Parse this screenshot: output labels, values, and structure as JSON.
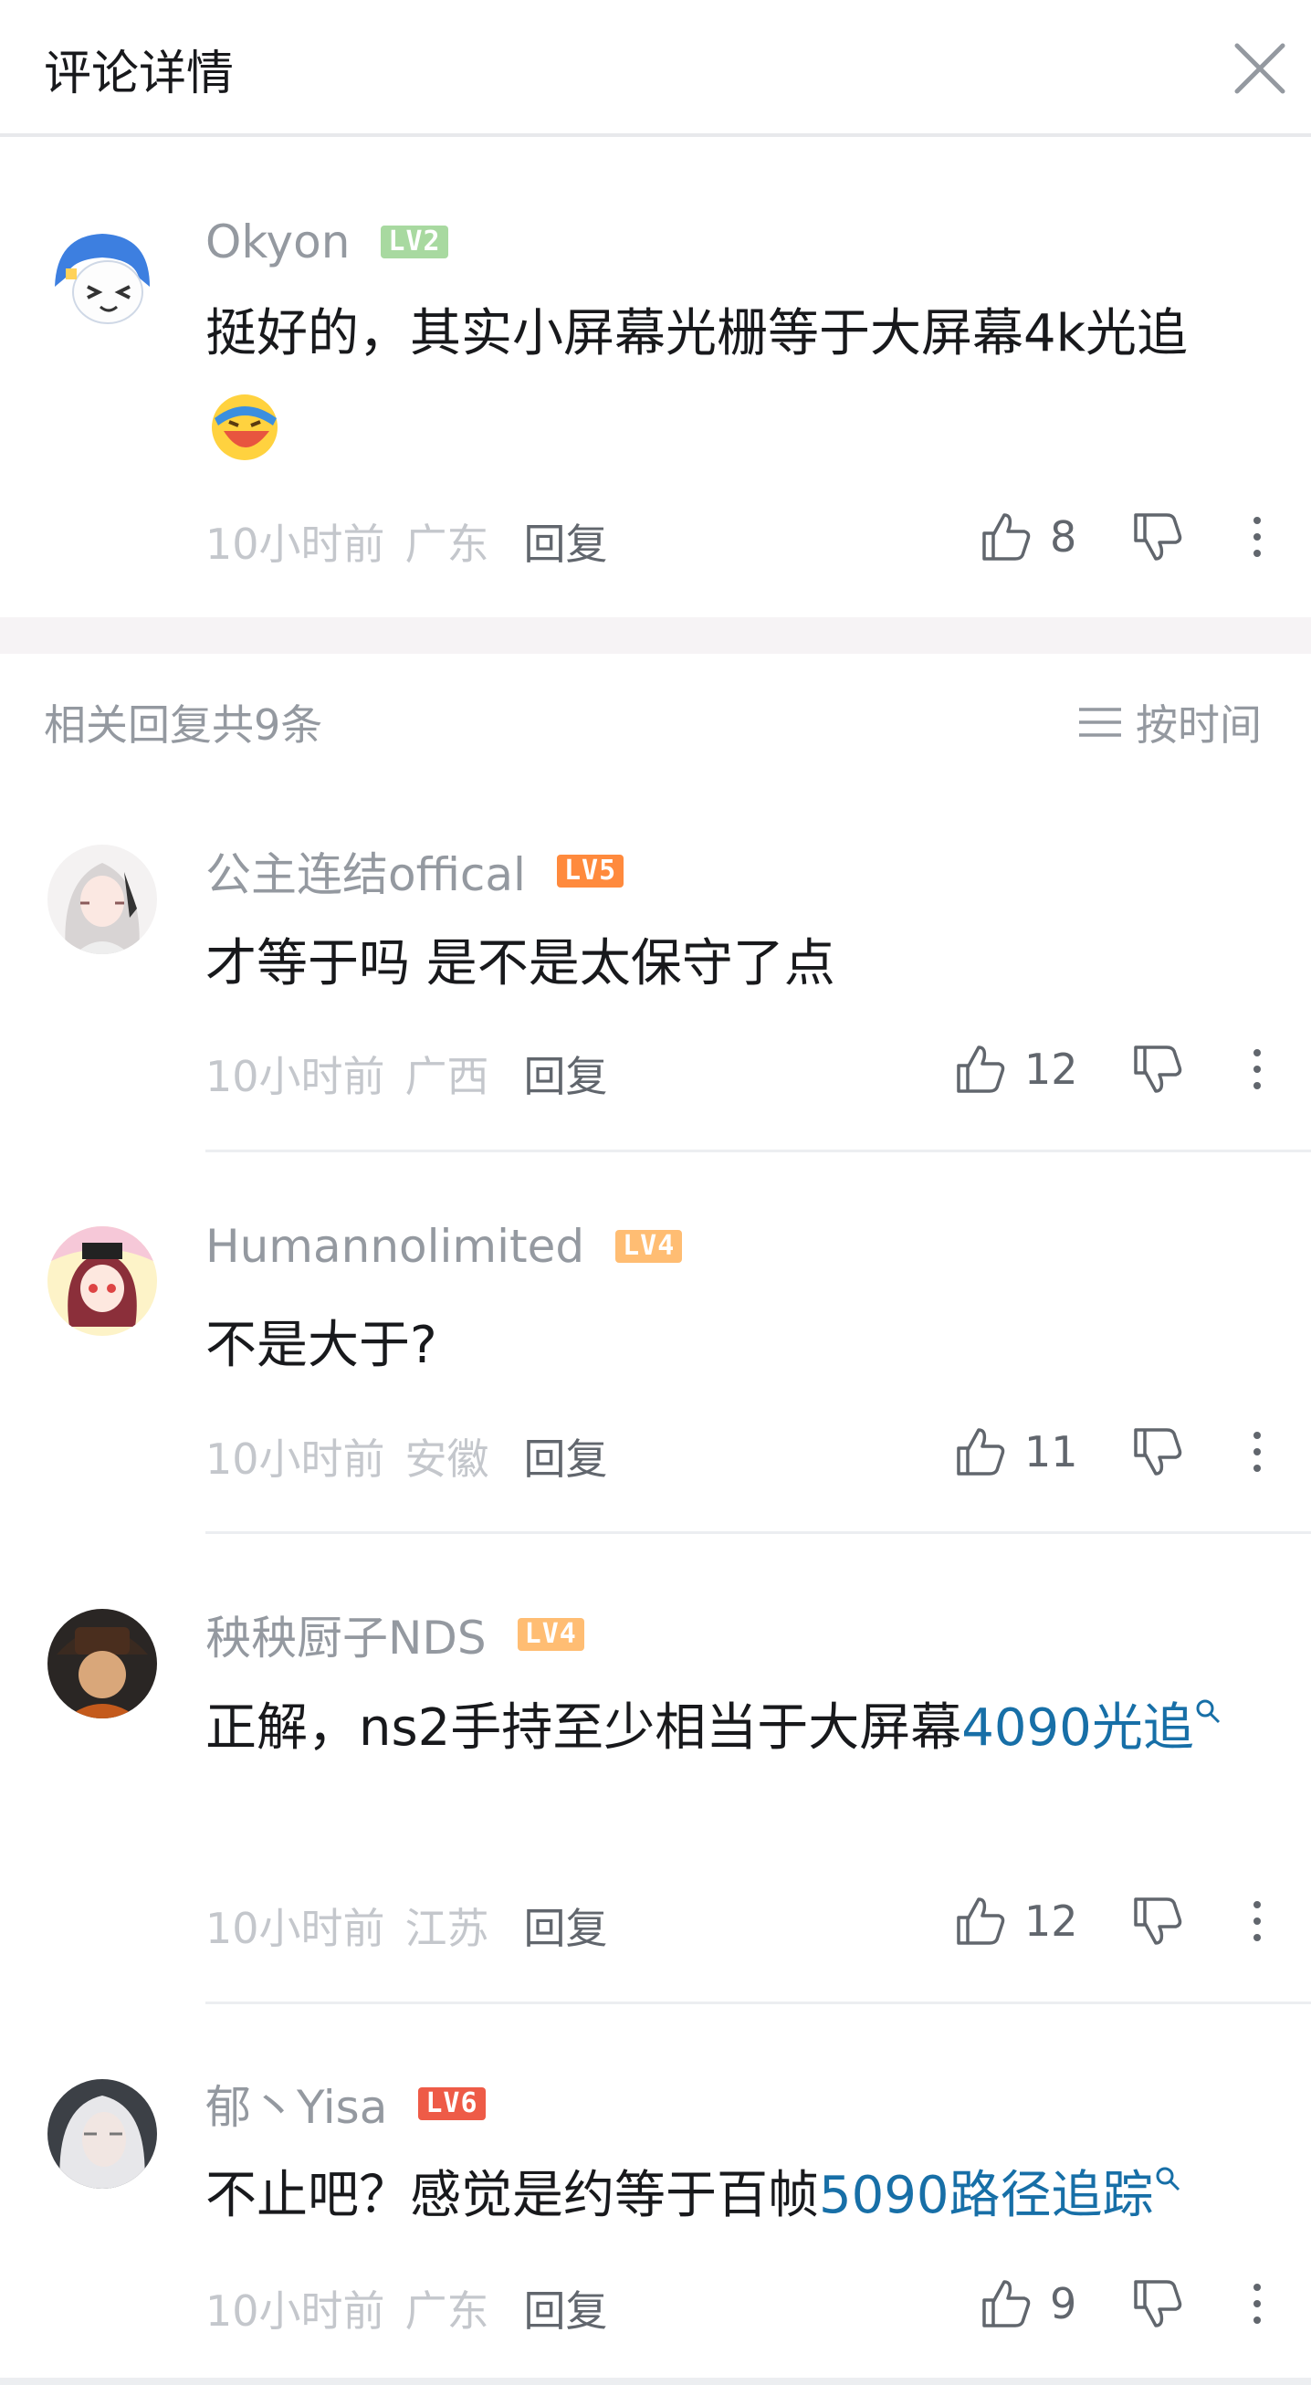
{
  "header": {
    "title": "评论详情"
  },
  "main_comment": {
    "username": "Okyon",
    "level": "LV2",
    "level_color": "#a8d9a0",
    "text": "挺好的，其实小屏幕光栅等于大屏幕4k光追",
    "time": "10小时前",
    "location": "广东",
    "reply_label": "回复",
    "likes": "8"
  },
  "replies_header": {
    "count_text": "相关回复共9条",
    "sort_label": "按时间"
  },
  "replies": [
    {
      "username": "公主连结offical",
      "level": "LV5",
      "level_color": "#ff8a3d",
      "text": "才等于吗 是不是太保守了点",
      "time": "10小时前",
      "location": "广西",
      "reply_label": "回复",
      "likes": "12"
    },
    {
      "username": "Humannolimited",
      "level": "LV4",
      "level_color": "#ffbd73",
      "text": "不是大于?",
      "time": "10小时前",
      "location": "安徽",
      "reply_label": "回复",
      "likes": "11"
    },
    {
      "username": "秧秧厨子NDS",
      "level": "LV4",
      "level_color": "#ffbd73",
      "text_plain": "正解，ns2手持至少相当于大屏幕",
      "text_link": "4090光追",
      "time": "10小时前",
      "location": "江苏",
      "reply_label": "回复",
      "likes": "12"
    },
    {
      "username": "郁丶Yisa",
      "level": "LV6",
      "level_color": "#ee5b47",
      "text_plain": "不止吧？感觉是约等于百帧",
      "text_link": "5090路径追踪",
      "time": "10小时前",
      "location": "广东",
      "reply_label": "回复",
      "likes": "9"
    }
  ]
}
